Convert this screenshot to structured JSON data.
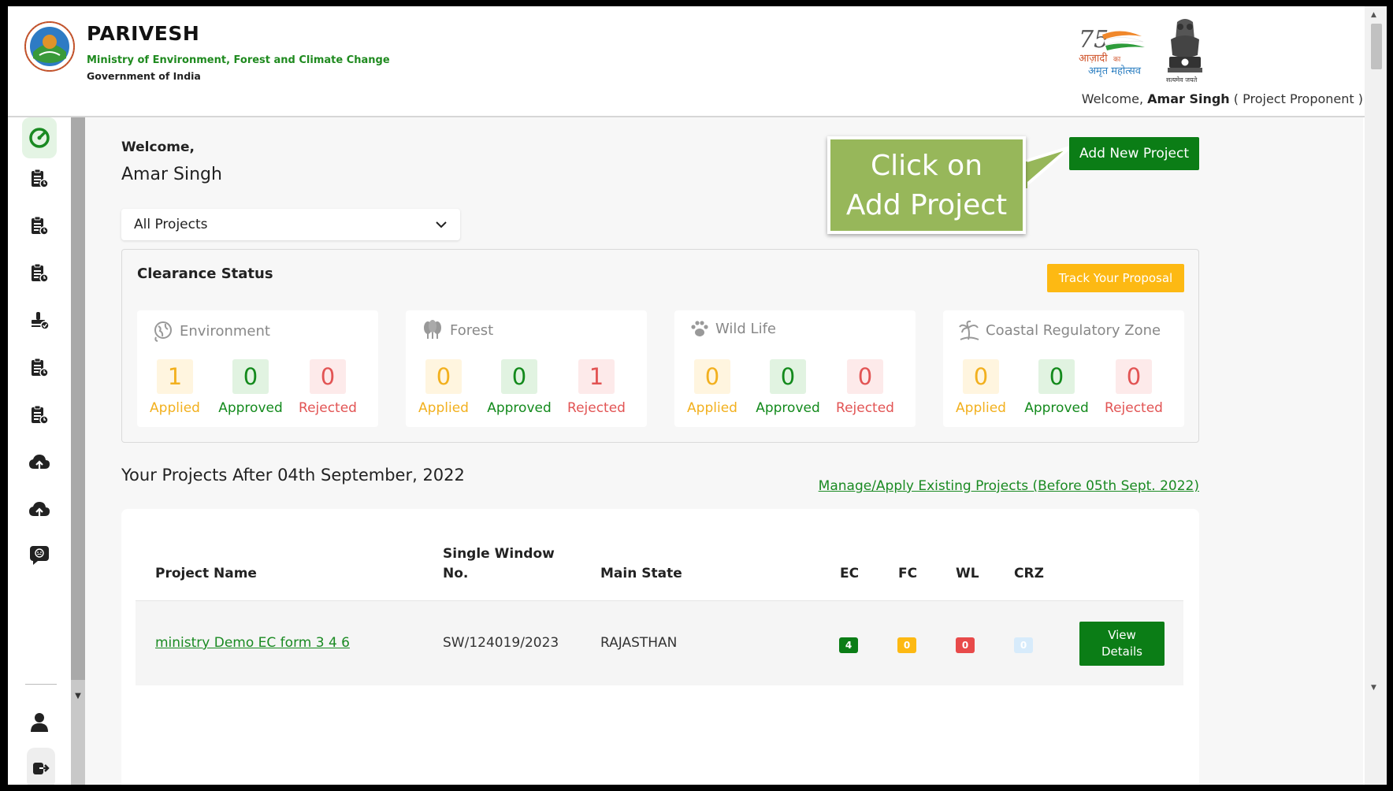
{
  "header": {
    "title": "PARIVESH",
    "ministry": "Ministry of Environment, Forest and Climate Change",
    "government": "Government of India",
    "welcome_prefix": "Welcome, ",
    "user_name": "Amar Singh",
    "role": " ( Project Proponent )",
    "azadi_text_1": "आज़ादी",
    "azadi_text_2": "का",
    "azadi_text_3": "अमृत महोत्सव",
    "azadi_number": "75",
    "emblem_motto": "सत्यमेव जयते"
  },
  "sidebar": {
    "items": [
      "dashboard-icon",
      "clipboard-icon",
      "clipboard-icon",
      "clipboard-icon",
      "stamp-icon",
      "clipboard-icon",
      "clipboard-icon",
      "cloud-upload-icon",
      "cloud-upload-icon",
      "chat-icon",
      "user-icon",
      "logout-icon"
    ]
  },
  "main": {
    "welcome": "Welcome,",
    "name": "Amar Singh",
    "project_filter": "All Projects",
    "add_button": "Add New Project",
    "callout_line1": "Click on",
    "callout_line2": "Add Project",
    "clearance_title": "Clearance Status",
    "track_button": "Track Your Proposal",
    "cards": [
      {
        "title": "Environment",
        "applied": "1",
        "approved": "0",
        "rejected": "0"
      },
      {
        "title": "Forest",
        "applied": "0",
        "approved": "0",
        "rejected": "1"
      },
      {
        "title": "Wild Life",
        "applied": "0",
        "approved": "0",
        "rejected": "0"
      },
      {
        "title": "Coastal Regulatory Zone",
        "applied": "0",
        "approved": "0",
        "rejected": "0"
      }
    ],
    "labels": {
      "applied": "Applied",
      "approved": "Approved",
      "rejected": "Rejected"
    },
    "projects_title": "Your Projects After 04th September, 2022",
    "manage_link": "Manage/Apply Existing Projects (Before 05th Sept. 2022)",
    "table": {
      "headers": {
        "project_name": "Project Name",
        "single_window_1": "Single Window",
        "single_window_2": "No.",
        "main_state": "Main State",
        "ec": "EC",
        "fc": "FC",
        "wl": "WL",
        "crz": "CRZ"
      },
      "rows": [
        {
          "project_name": "ministry Demo EC form 3 4 6",
          "single_window": "SW/124019/2023",
          "main_state": "RAJASTHAN",
          "ec": "4",
          "fc": "0",
          "wl": "0",
          "crz": "0",
          "action_1": "View",
          "action_2": "Details"
        }
      ]
    }
  },
  "colors": {
    "primary_green": "#0b7d16",
    "ministry_green": "#1f8a1f",
    "track_yellow": "#fdb913",
    "callout_green": "#97b75a",
    "applied": "#f2b01e",
    "approved": "#138a1c",
    "rejected": "#e25454",
    "badge_crz": "#d7ebfb"
  }
}
